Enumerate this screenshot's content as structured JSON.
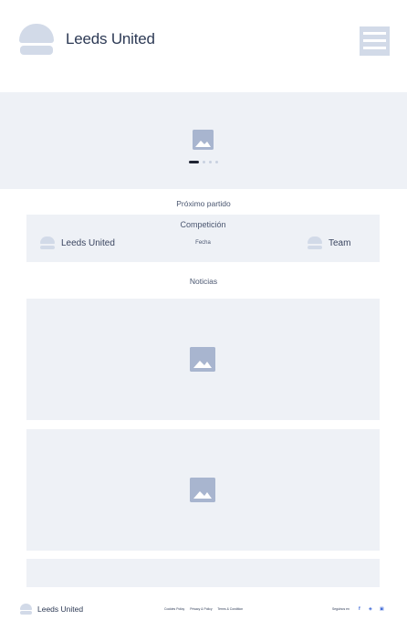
{
  "header": {
    "brand_name": "Leeds United",
    "menu_icon": "hamburger-icon"
  },
  "hero": {
    "image_icon": "image-placeholder-icon",
    "carousel_slide_count": 4,
    "carousel_active_index": 0
  },
  "match": {
    "section_title": "Próximo partido",
    "competition": "Competición",
    "date": "Fecha",
    "home_team": "Leeds United",
    "away_team": "Team"
  },
  "news": {
    "section_title": "Noticias",
    "image_icon": "image-placeholder-icon"
  },
  "footer": {
    "brand_name": "Leeds United",
    "links": [
      "Cookies Policy",
      "Privacy & Policy",
      "Terms & Condition"
    ],
    "follow_label": "Segúinos en",
    "social_icons": [
      "facebook-icon",
      "twitter-icon",
      "instagram-icon"
    ]
  },
  "colors": {
    "placeholder_bg": "#eef1f6",
    "logo_shape": "#d2dae8",
    "image_icon": "#a8b5cf",
    "text": "#2d3a55",
    "social": "#3b66d6"
  }
}
